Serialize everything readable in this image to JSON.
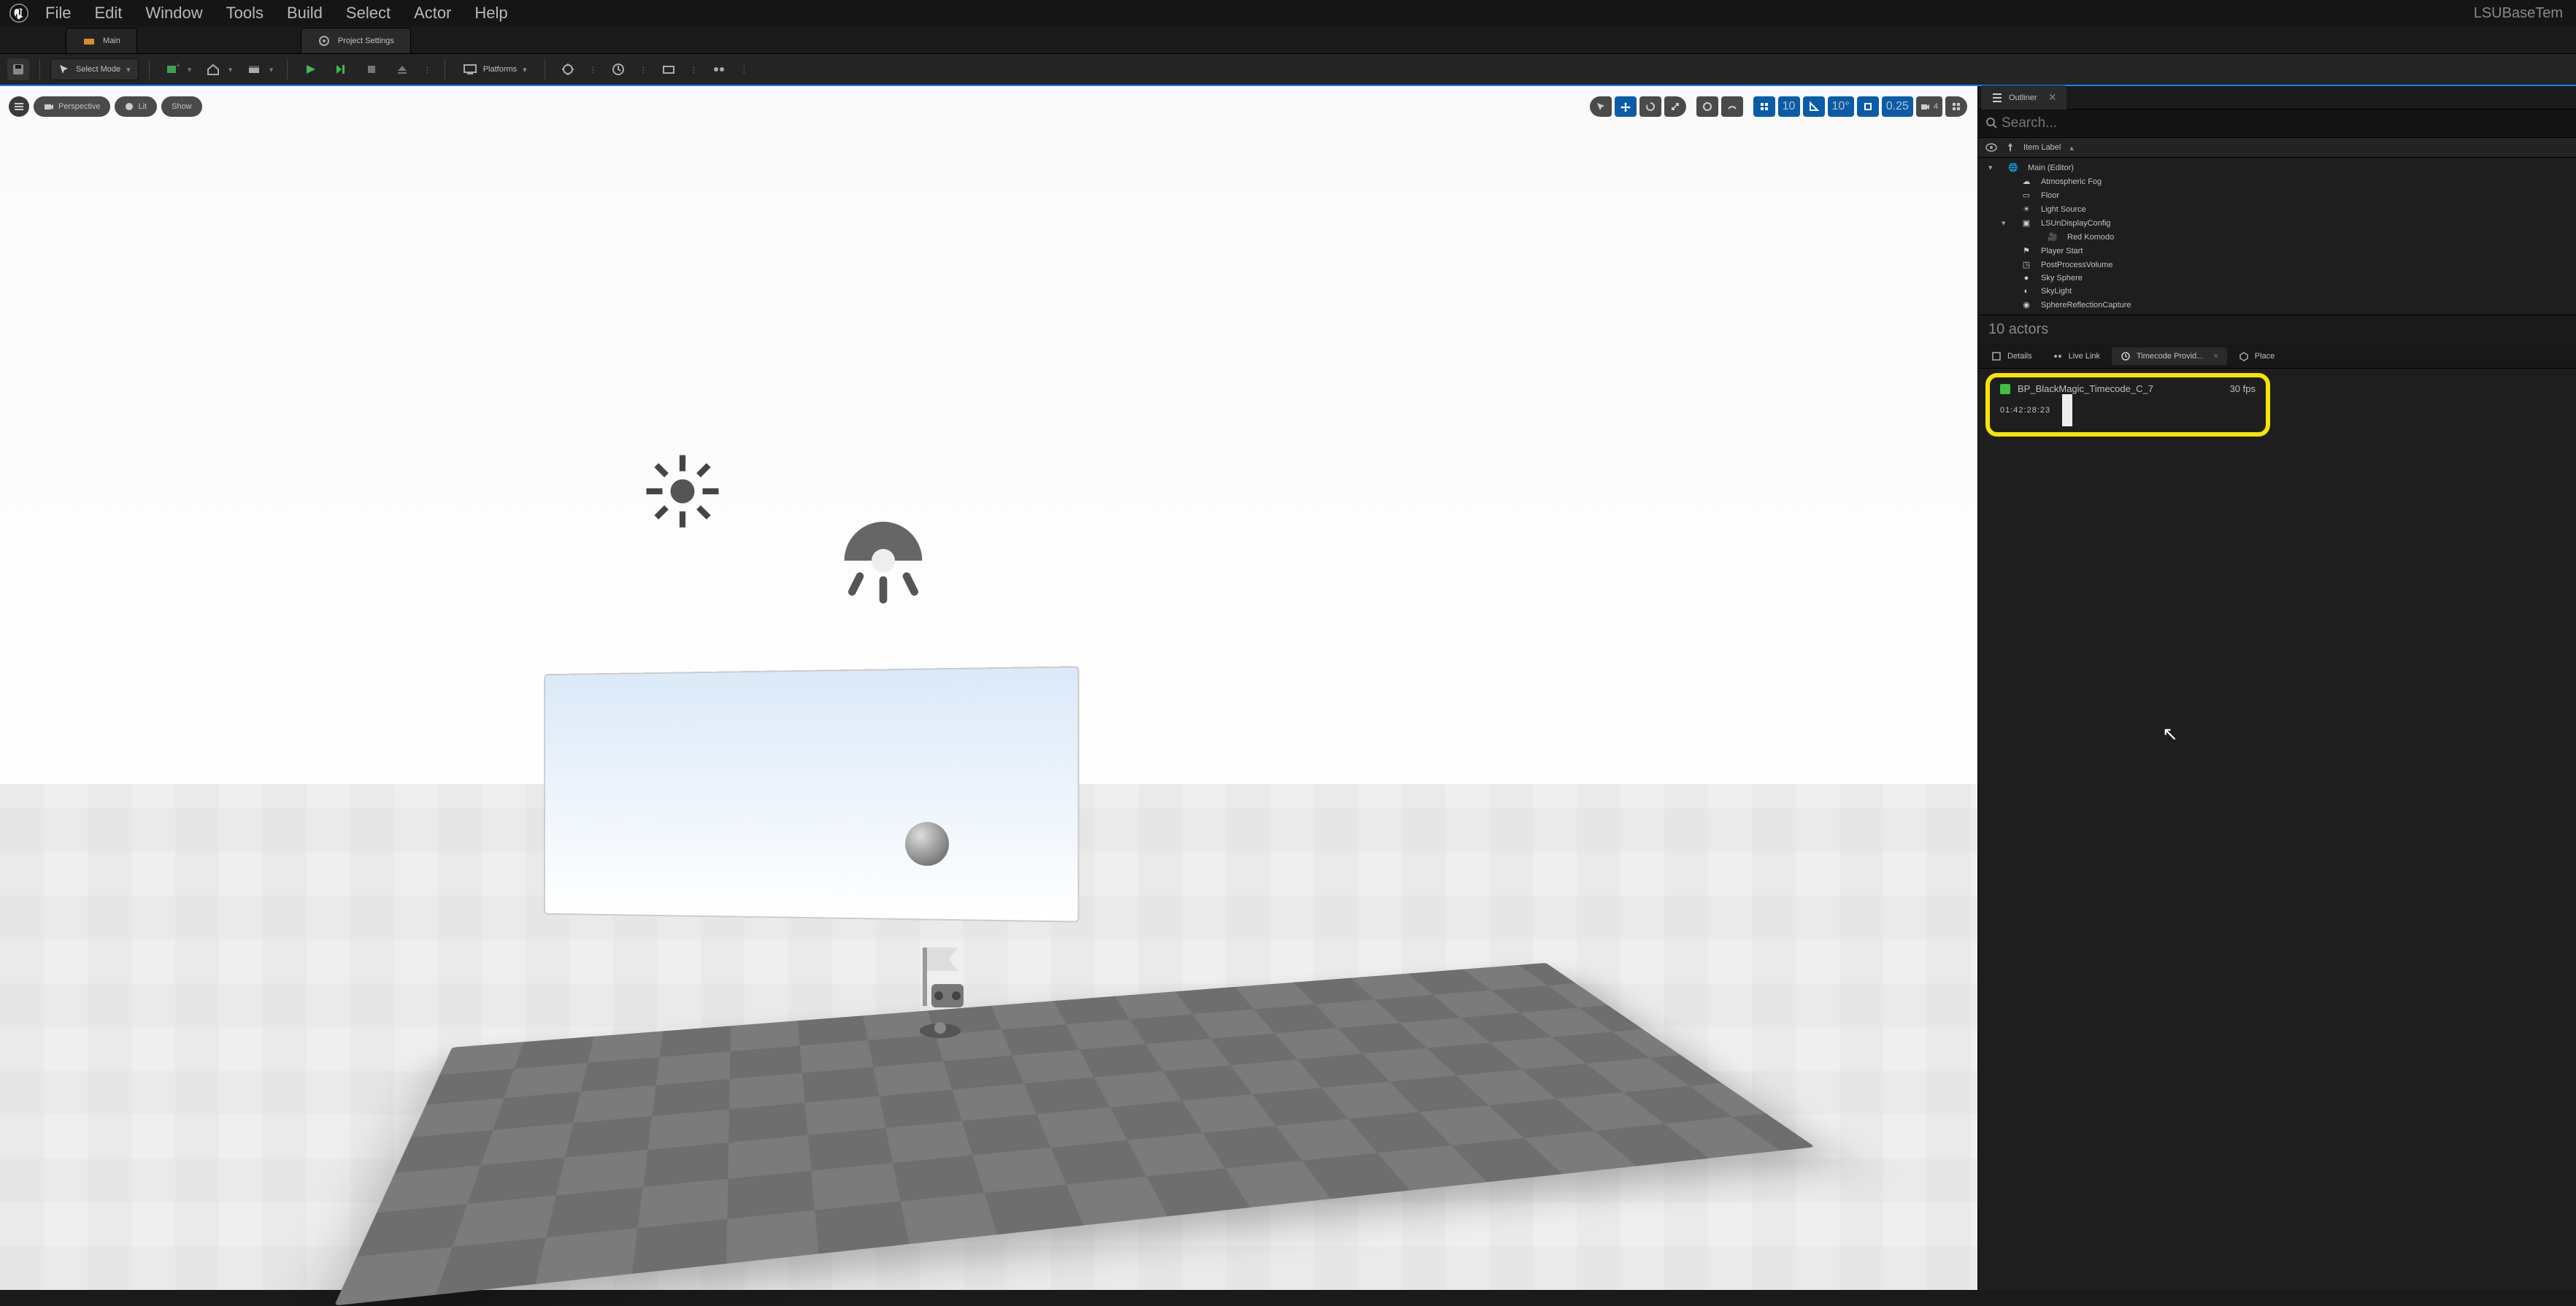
{
  "menu": {
    "items": [
      "File",
      "Edit",
      "Window",
      "Tools",
      "Build",
      "Select",
      "Actor",
      "Help"
    ]
  },
  "title_right": "LSUBaseTem",
  "tabs": [
    {
      "label": "Main",
      "icon": "level"
    },
    {
      "label": "Project Settings",
      "icon": "settings"
    }
  ],
  "toolbar": {
    "mode_label": "Select Mode",
    "platforms_label": "Platforms"
  },
  "viewport": {
    "left_pills": [
      "Perspective",
      "Lit",
      "Show"
    ],
    "grid_snap": "10",
    "angle_snap": "10°",
    "scale_snap": "0.25",
    "cam_speed": "4"
  },
  "outliner": {
    "tab": "Outliner",
    "search_placeholder": "Search...",
    "header_label": "Item Label",
    "root": "Main (Editor)",
    "items": [
      {
        "label": "Atmospheric Fog",
        "icon": "cloud"
      },
      {
        "label": "Floor",
        "icon": "plane"
      },
      {
        "label": "Light Source",
        "icon": "sun"
      },
      {
        "label": "LSUnDisplayConfig",
        "icon": "display",
        "expandable": true
      },
      {
        "label": "Red Komodo",
        "icon": "camera",
        "child": true
      },
      {
        "label": "Player Start",
        "icon": "flag"
      },
      {
        "label": "PostProcessVolume",
        "icon": "cube"
      },
      {
        "label": "Sky Sphere",
        "icon": "sphere"
      },
      {
        "label": "SkyLight",
        "icon": "sky"
      },
      {
        "label": "SphereReflectionCapture",
        "icon": "reflect"
      }
    ],
    "status": "10 actors"
  },
  "lower": {
    "tabs": [
      "Details",
      "Live Link",
      "Timecode Provid...",
      "Place"
    ],
    "active": 2
  },
  "timecode": {
    "source": "BP_BlackMagic_Timecode_C_7",
    "fps": "30 fps",
    "value": "01:42:28:23"
  }
}
